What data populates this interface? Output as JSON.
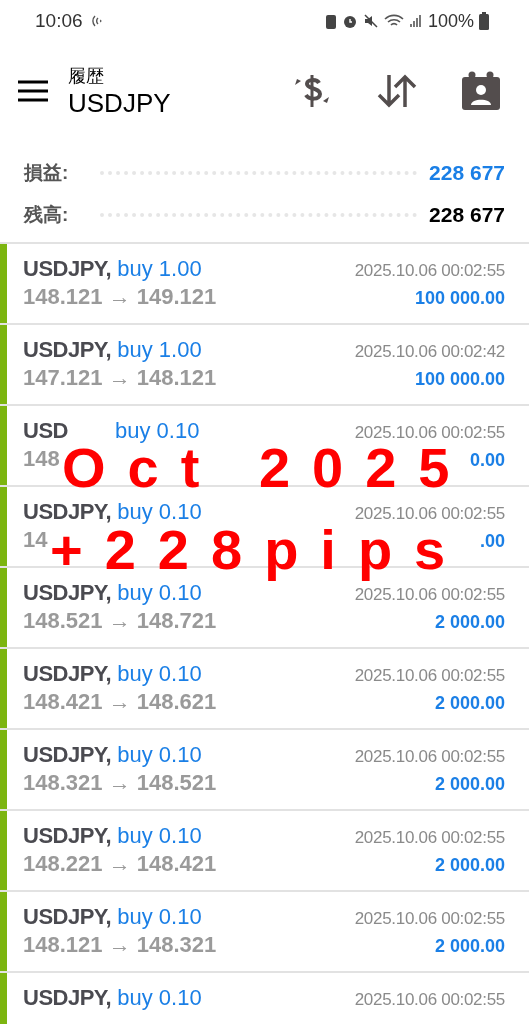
{
  "status_bar": {
    "time": "10:06",
    "battery": "100%"
  },
  "header": {
    "subtitle": "履歴",
    "title": "USDJPY"
  },
  "summary": [
    {
      "label": "損益:",
      "value": "228 677",
      "kind": "profit"
    },
    {
      "label": "残高:",
      "value": "228 677",
      "kind": "balance"
    }
  ],
  "deals": [
    {
      "symbol": "USDJPY,",
      "side": "buy 1.00",
      "time": "2025.10.06 00:02:55",
      "prices": "148.121 → 149.121",
      "profit": "100 000.00"
    },
    {
      "symbol": "USDJPY,",
      "side": "buy 1.00",
      "time": "2025.10.06 00:02:42",
      "prices": "147.121 → 148.121",
      "profit": "100 000.00"
    },
    {
      "symbol": "USD",
      "side": "buy 0.10",
      "time": "2025.10.06 00:02:55",
      "prices": "148",
      "profit": "0.00"
    },
    {
      "symbol": "USDJPY,",
      "side": "buy 0.10",
      "time": "2025.10.06 00:02:55",
      "prices": "14",
      "profit": ".00"
    },
    {
      "symbol": "USDJPY,",
      "side": "buy 0.10",
      "time": "2025.10.06 00:02:55",
      "prices": "148.521 → 148.721",
      "profit": "2 000.00"
    },
    {
      "symbol": "USDJPY,",
      "side": "buy 0.10",
      "time": "2025.10.06 00:02:55",
      "prices": "148.421 → 148.621",
      "profit": "2 000.00"
    },
    {
      "symbol": "USDJPY,",
      "side": "buy 0.10",
      "time": "2025.10.06 00:02:55",
      "prices": "148.321 → 148.521",
      "profit": "2 000.00"
    },
    {
      "symbol": "USDJPY,",
      "side": "buy 0.10",
      "time": "2025.10.06 00:02:55",
      "prices": "148.221 → 148.421",
      "profit": "2 000.00"
    },
    {
      "symbol": "USDJPY,",
      "side": "buy 0.10",
      "time": "2025.10.06 00:02:55",
      "prices": "148.121 → 148.321",
      "profit": "2 000.00"
    },
    {
      "symbol": "USDJPY,",
      "side": "buy 0.10",
      "time": "2025.10.06 00:02:55"
    }
  ],
  "overlay": {
    "lines": [
      "Oct 2025",
      "+228pips"
    ]
  }
}
